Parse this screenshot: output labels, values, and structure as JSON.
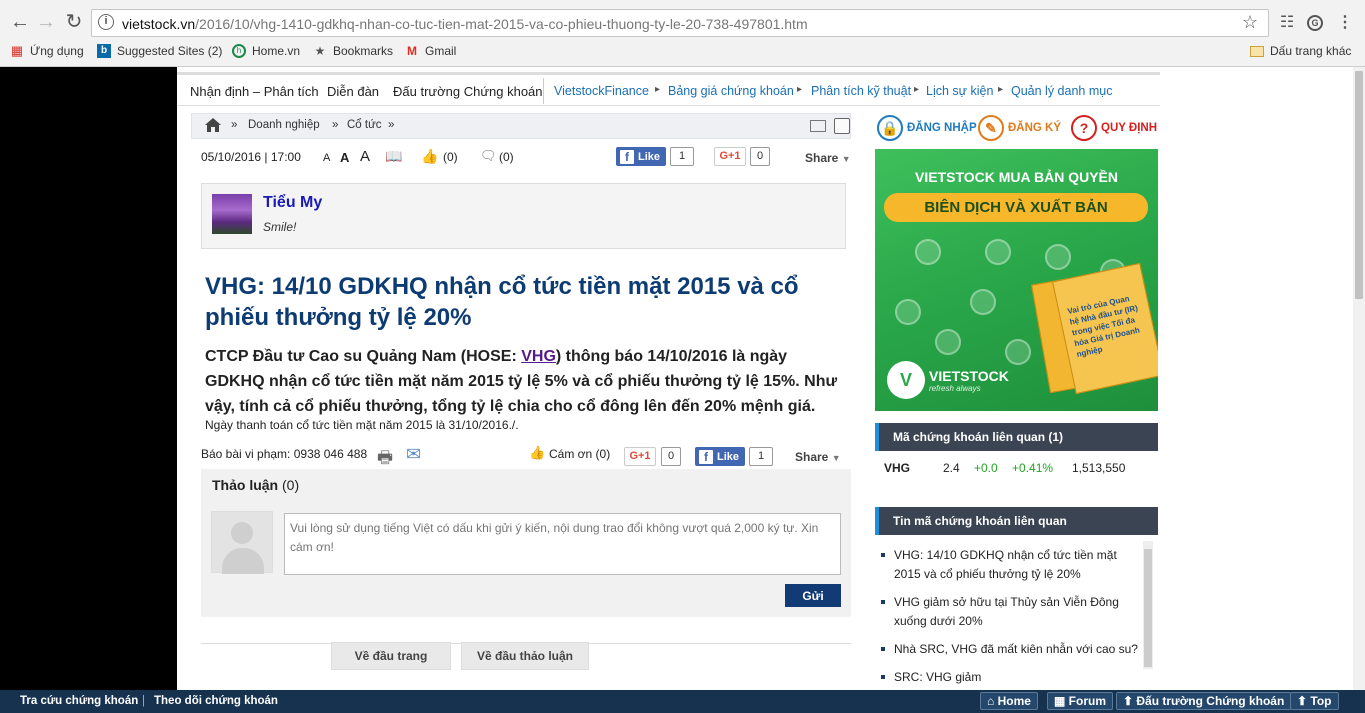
{
  "browser": {
    "url_host": "vietstock.vn",
    "url_path": "/2016/10/vhg-1410-gdkhq-nhan-co-tuc-tien-mat-2015-va-co-phieu-thuong-ty-le-20-738-497801.htm",
    "bookmarks": [
      "Ứng dụng",
      "Suggested Sites (2)",
      "Home.vn",
      "Bookmarks",
      "Gmail"
    ],
    "other_bookmarks": "Dấu trang khác"
  },
  "menu": {
    "left": [
      "Nhận định – Phân tích",
      "Diễn đàn",
      "Đấu trường Chứng khoán"
    ],
    "right": [
      "VietstockFinance",
      "Bảng giá chứng khoán",
      "Phân tích kỹ thuật",
      "Lịch sự kiện",
      "Quản lý danh mục"
    ]
  },
  "breadcrumb": [
    "Doanh nghiệp",
    "Cổ tức"
  ],
  "meta": {
    "datetime": "05/10/2016 | 17:00",
    "font_sizes": [
      "A",
      "A",
      "A"
    ],
    "likes": "(0)",
    "comments": "(0)",
    "fb_like": "Like",
    "fb_count": "1",
    "gplus": "G+1",
    "gplus_count": "0",
    "share": "Share"
  },
  "author": {
    "name": "Tiểu My",
    "status": "Smile!"
  },
  "article": {
    "title": "VHG: 14/10 GDKHQ nhận cổ tức tiền mặt 2015 và cổ phiếu thưởng tỷ lệ 20%",
    "lead_pre": "CTCP Đầu tư Cao su Quảng Nam (HOSE: ",
    "lead_link": "VHG",
    "lead_post": ") thông báo 14/10/2016 là ngày GDKHQ nhận cổ tức tiền mặt năm 2015 tỷ lệ 5% và  cổ phiếu thưởng tỷ lệ 15%. Như vậy, tính cả cổ phiếu thưởng, tổng tỷ lệ chia cho cổ đông lên đến 20% mệnh giá.",
    "body": "Ngày thanh toán cổ tức tiền mặt năm 2015 là 31/10/2016./."
  },
  "tools": {
    "report": "Báo bài vi phạm: 0938 046 488",
    "thanks": "Cám ơn (0)",
    "gplus": "G+1",
    "gplus_count": "0",
    "fb_like": "Like",
    "fb_count": "1",
    "share": "Share"
  },
  "discussion": {
    "title": "Thảo luận",
    "count": "(0)",
    "placeholder": "Vui lòng sử dụng tiếng Việt có dấu khi gửi ý kiến, nội dung trao đổi không vượt quá 2,000 ký tự. Xin cám ơn!",
    "send": "Gửi"
  },
  "back": {
    "top": "Về đầu trang",
    "discussion": "Về đầu thảo luận"
  },
  "side": {
    "login": "ĐĂNG NHẬP",
    "register": "ĐĂNG KÝ",
    "rules": "QUY ĐỊNH",
    "ad_line1": "VIETSTOCK MUA BẢN QUYỀN",
    "ad_line2": "BIÊN DỊCH VÀ XUẤT BẢN",
    "ad_book": "Vai trò của Quan hệ Nhà đầu tư (IR) trong việc Tối đa hóa Giá trị Doanh nghiệp",
    "ad_brand": "VIETSTOCK",
    "ad_slogan": "refresh always",
    "codes_title": "Mã chứng khoán liên quan (1)",
    "codes": [
      {
        "sym": "VHG",
        "price": "2.4",
        "chg": "+0.0",
        "pct": "+0.41%",
        "vol": "1,513,550"
      }
    ],
    "news_title": "Tin mã chứng khoán liên quan",
    "news": [
      "VHG: 14/10 GDKHQ nhận cổ tức tiền mặt 2015 và cổ phiếu thưởng tỷ lệ 20%",
      "VHG giảm sở hữu tại Thủy sản Viễn Đông xuống dưới 20%",
      "Nhà SRC, VHG đã mất kiên nhẫn với cao su?",
      "SRC: VHG giảm"
    ]
  },
  "footer": {
    "left": [
      "Tra cứu chứng khoán",
      "Theo dõi chứng khoán"
    ],
    "right": [
      "Home",
      "Forum",
      "Đấu trường Chứng khoán",
      "Top"
    ]
  },
  "colors": {
    "accent": "#0d3b73",
    "fb": "#4267b2",
    "up": "#22a322",
    "footer": "#17324f"
  }
}
